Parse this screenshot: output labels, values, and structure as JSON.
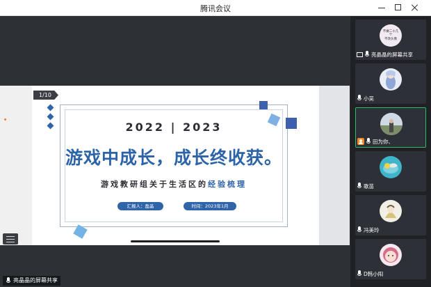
{
  "window": {
    "title": "腾讯会议"
  },
  "slide": {
    "page": "1/10",
    "year": "2022 | 2023",
    "headline": "游戏中成长，成长终收获。",
    "subtitle_main": "游戏教研组关于生活区的",
    "subtitle_highlight": "经验梳理",
    "reporter": "汇报人：盈晶",
    "time": "时间：2023年1月"
  },
  "share_status": "亮晶晶的屏幕共享",
  "participants": [
    {
      "name": "亮晶晶的屏幕共享",
      "avatar_text": [
        "不做二十几",
        "个",
        "不改头像"
      ],
      "icon": "screen-share-icon"
    },
    {
      "name": "小吴",
      "icon": "mic-icon"
    },
    {
      "name": "田为你、",
      "icon": "mic-icon",
      "camera": true,
      "active": true
    },
    {
      "name": "歌苗",
      "icon": "mic-icon"
    },
    {
      "name": "冯美玲",
      "icon": "mic-icon"
    },
    {
      "name": "D韩小阳",
      "icon": "mic-icon"
    }
  ],
  "colors": {
    "accent": "#2d64a8",
    "speaking_border": "#2bbd6a",
    "main_bg": "#2d3034"
  }
}
